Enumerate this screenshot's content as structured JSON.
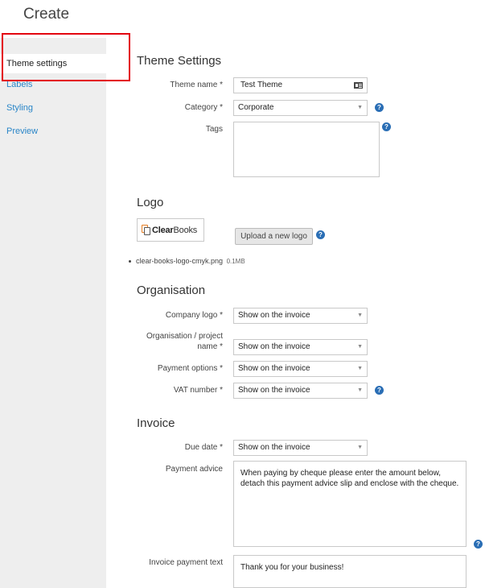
{
  "page": {
    "title": "Create"
  },
  "sidebar": {
    "items": [
      {
        "label": "Theme settings",
        "active": true
      },
      {
        "label": "Labels"
      },
      {
        "label": "Styling"
      },
      {
        "label": "Preview"
      }
    ]
  },
  "theme_settings": {
    "title": "Theme Settings",
    "theme_name": {
      "label": "Theme name *",
      "value": "Test Theme"
    },
    "category": {
      "label": "Category *",
      "value": "Corporate"
    },
    "tags": {
      "label": "Tags",
      "value": ""
    }
  },
  "logo": {
    "title": "Logo",
    "brand": {
      "part1": "Clear",
      "part2": "Books"
    },
    "upload_label": "Upload a new logo",
    "file": {
      "name": "clear-books-logo-cmyk.png",
      "size": "0.1MB"
    }
  },
  "organisation": {
    "title": "Organisation",
    "company_logo": {
      "label": "Company logo *",
      "value": "Show on the invoice"
    },
    "org_name": {
      "label_line1": "Organisation / project",
      "label_line2": "name *",
      "value": "Show on the invoice"
    },
    "payment_options": {
      "label": "Payment options *",
      "value": "Show on the invoice"
    },
    "vat_number": {
      "label": "VAT number *",
      "value": "Show on the invoice"
    }
  },
  "invoice": {
    "title": "Invoice",
    "due_date": {
      "label": "Due date *",
      "value": "Show on the invoice"
    },
    "payment_advice": {
      "label": "Payment advice",
      "value": "When paying by cheque please enter the amount below, detach this payment advice slip and enclose with the cheque."
    },
    "payment_text": {
      "label": "Invoice payment text",
      "value": "Thank you for your business!"
    }
  },
  "icons": {
    "help": "?",
    "select_arrow": "▼"
  },
  "colors": {
    "accent": "#2a86c8",
    "help": "#2a6eb5",
    "highlight": "#e3000f"
  }
}
